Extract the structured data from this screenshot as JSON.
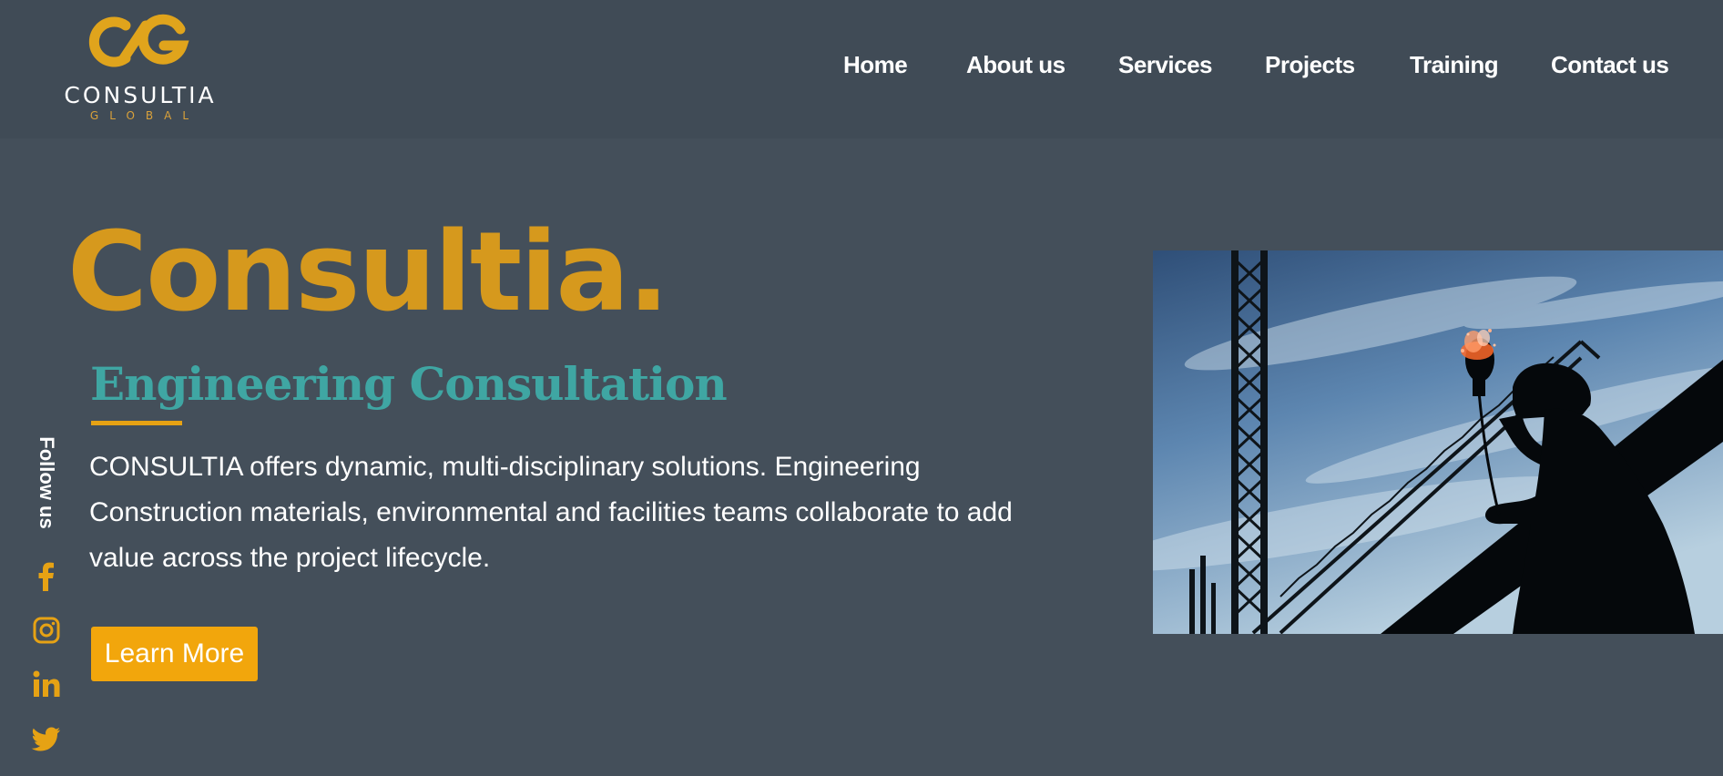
{
  "brand": {
    "name": "CONSULTIA",
    "sub": "GLOBAL",
    "colors": {
      "gold": "#d6991d",
      "teal": "#3fa6a3",
      "button": "#f2a60c",
      "background": "#444f5a"
    }
  },
  "nav": {
    "items": [
      {
        "label": "Home"
      },
      {
        "label": "About us"
      },
      {
        "label": "Services"
      },
      {
        "label": "Projects"
      },
      {
        "label": "Training"
      },
      {
        "label": "Contact us"
      }
    ]
  },
  "hero": {
    "title": "Consultia.",
    "subtitle": "Engineering Consultation",
    "description": "CONSULTIA offers dynamic, multi-disciplinary solutions. Engineering Construction materials, environmental and facilities teams collaborate to add value across the project lifecycle.",
    "cta_label": "Learn More",
    "image_icon": "construction-silhouette-photo"
  },
  "social": {
    "label": "Follow us",
    "icons": [
      "facebook-icon",
      "instagram-icon",
      "linkedin-icon",
      "twitter-icon"
    ]
  }
}
